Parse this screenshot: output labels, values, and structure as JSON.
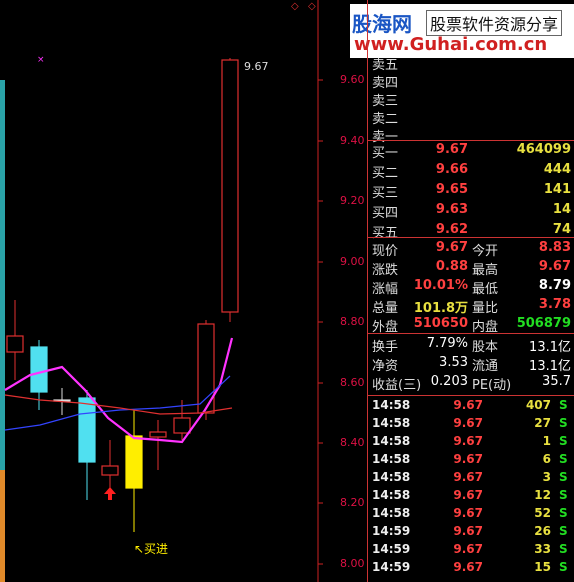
{
  "logo": {
    "brand": "股海网",
    "tagline": "股票软件资源分享",
    "url": "www.Guhai.com.cn"
  },
  "chart": {
    "y_axis_labels": [
      "9.60",
      "9.40",
      "9.20",
      "9.00",
      "8.80",
      "8.60",
      "8.40",
      "8.20",
      "8.00"
    ],
    "high_annotation": "9.67",
    "buy_signal_label": "↖买进",
    "colors": {
      "up": "#e03030",
      "down": "#50e0f0",
      "signal": "#ffee00",
      "ma_fast": "#ff33ff",
      "ma_mid": "#3344ff",
      "ma_slow": "#e03030",
      "grid": "#cc2222"
    }
  },
  "panel": {
    "sell_levels": [
      {
        "label": "卖五"
      },
      {
        "label": "卖四"
      },
      {
        "label": "卖三"
      },
      {
        "label": "卖二"
      },
      {
        "label": "卖一"
      }
    ],
    "buy_levels": [
      {
        "label": "买一",
        "price": "9.67",
        "volume": "464099"
      },
      {
        "label": "买二",
        "price": "9.66",
        "volume": "444"
      },
      {
        "label": "买三",
        "price": "9.65",
        "volume": "141"
      },
      {
        "label": "买四",
        "price": "9.63",
        "volume": "14"
      },
      {
        "label": "买五",
        "price": "9.62",
        "volume": "74"
      }
    ],
    "quote": [
      {
        "l1": "现价",
        "v1": "9.67",
        "l2": "今开",
        "v2": "8.83"
      },
      {
        "l1": "涨跌",
        "v1": "0.88",
        "l2": "最高",
        "v2": "9.67"
      },
      {
        "l1": "涨幅",
        "v1": "10.01%",
        "l2": "最低",
        "v2": "8.79"
      },
      {
        "l1": "总量",
        "v1": "101.8万",
        "l2": "量比",
        "v2": "3.78"
      },
      {
        "l1": "外盘",
        "v1": "510650",
        "l2": "内盘",
        "v2": "506879"
      }
    ],
    "fundamentals": [
      {
        "l1": "换手",
        "v1": "7.79%",
        "l2": "股本",
        "v2": "13.1亿"
      },
      {
        "l1": "净资",
        "v1": "3.53",
        "l2": "流通",
        "v2": "13.1亿"
      },
      {
        "l1": "收益(三)",
        "v1": "0.203",
        "l2": "PE(动)",
        "v2": "35.7"
      }
    ],
    "trades": [
      {
        "time": "14:58",
        "price": "9.67",
        "vol": "407",
        "side": "S"
      },
      {
        "time": "14:58",
        "price": "9.67",
        "vol": "27",
        "side": "S"
      },
      {
        "time": "14:58",
        "price": "9.67",
        "vol": "1",
        "side": "S"
      },
      {
        "time": "14:58",
        "price": "9.67",
        "vol": "6",
        "side": "S"
      },
      {
        "time": "14:58",
        "price": "9.67",
        "vol": "3",
        "side": "S"
      },
      {
        "time": "14:58",
        "price": "9.67",
        "vol": "12",
        "side": "S"
      },
      {
        "time": "14:58",
        "price": "9.67",
        "vol": "52",
        "side": "S"
      },
      {
        "time": "14:59",
        "price": "9.67",
        "vol": "26",
        "side": "S"
      },
      {
        "time": "14:59",
        "price": "9.67",
        "vol": "33",
        "side": "S"
      },
      {
        "time": "14:59",
        "price": "9.67",
        "vol": "15",
        "side": "S"
      }
    ]
  }
}
